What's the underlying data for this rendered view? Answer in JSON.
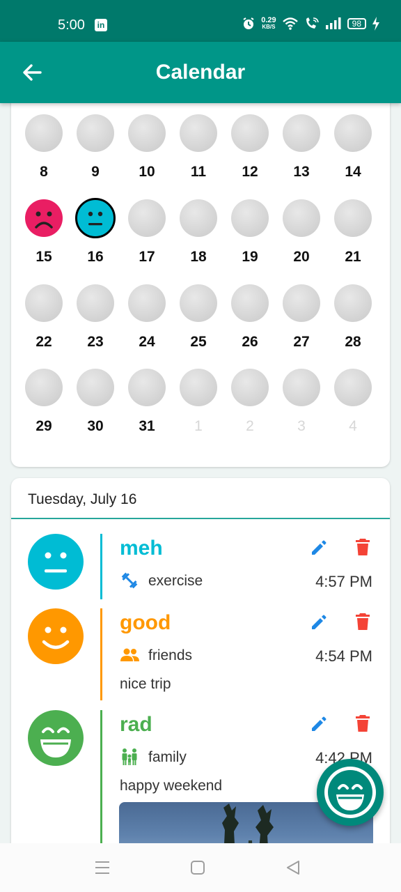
{
  "status_bar": {
    "time": "5:00",
    "linkedin_icon": "in",
    "net_speed_value": "0.29",
    "net_speed_unit": "KB/S",
    "battery": "98",
    "icons": [
      "linkedin-icon",
      "alarm-icon",
      "wifi-icon",
      "wifi-call-icon",
      "signal-icon",
      "battery-icon",
      "charging-icon"
    ]
  },
  "app_bar": {
    "title": "Calendar",
    "back_icon": "arrow-back-icon"
  },
  "calendar": {
    "weeks": [
      [
        "8",
        "9",
        "10",
        "11",
        "12",
        "13",
        "14"
      ],
      [
        "15",
        "16",
        "17",
        "18",
        "19",
        "20",
        "21"
      ],
      [
        "22",
        "23",
        "24",
        "25",
        "26",
        "27",
        "28"
      ],
      [
        "29",
        "30",
        "31",
        "1",
        "2",
        "3",
        "4"
      ]
    ],
    "mood_days": {
      "15": "sad",
      "16": "meh"
    },
    "selected_day": "16",
    "other_month_days": [
      "1",
      "2",
      "3",
      "4"
    ]
  },
  "day_detail": {
    "title": "Tuesday, July 16",
    "entries": [
      {
        "mood": "meh",
        "color": "#00bcd4",
        "activity": "exercise",
        "activity_icon": "dumbbell-icon",
        "time": "4:57 PM",
        "note": ""
      },
      {
        "mood": "good",
        "color": "#ff9800",
        "activity": "friends",
        "activity_icon": "people-icon",
        "time": "4:54 PM",
        "note": "nice trip"
      },
      {
        "mood": "rad",
        "color": "#4caf50",
        "activity": "family",
        "activity_icon": "family-icon",
        "time": "4:42 PM",
        "note": "happy weekend"
      }
    ]
  },
  "colors": {
    "primary": "#009688",
    "primary_dark": "#00796b",
    "edit": "#1e88e5",
    "delete": "#f44336",
    "sad": "#e91e63"
  },
  "fab": {
    "icon": "laughing-face-icon"
  },
  "nav_bar": {
    "icons": [
      "menu-icon",
      "home-square-icon",
      "back-triangle-icon"
    ]
  }
}
